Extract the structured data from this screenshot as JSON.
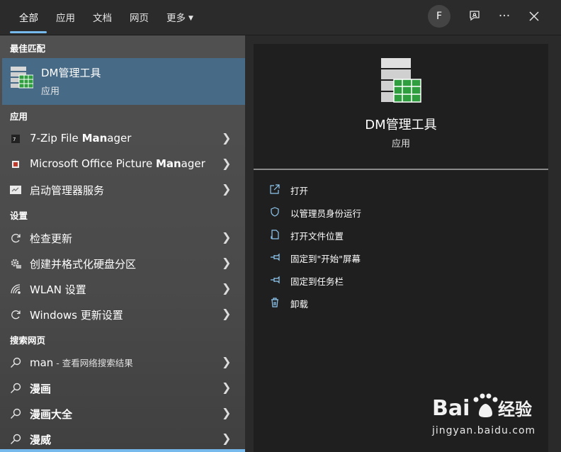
{
  "tabs": [
    {
      "label": "全部"
    },
    {
      "label": "应用"
    },
    {
      "label": "文档"
    },
    {
      "label": "网页"
    },
    {
      "label": "更多"
    }
  ],
  "avatar_letter": "F",
  "sections": {
    "best_match": "最佳匹配",
    "apps": "应用",
    "settings": "设置",
    "web": "搜索网页"
  },
  "best_match": {
    "title": "DM管理工具",
    "subtitle": "应用"
  },
  "apps": [
    {
      "pre": "7-Zip File ",
      "bold": "Man",
      "post": "ager",
      "icon": "7zip-icon"
    },
    {
      "pre": "Microsoft Office Picture ",
      "bold": "Man",
      "post": "ager",
      "icon": "office-picture-icon"
    },
    {
      "pre": "启动管理器服务",
      "bold": "",
      "post": "",
      "icon": "service-icon"
    }
  ],
  "settings": [
    {
      "label": "检查更新",
      "icon": "refresh-icon"
    },
    {
      "label": "创建并格式化硬盘分区",
      "icon": "disk-gear-icon"
    },
    {
      "label": "WLAN 设置",
      "icon": "wifi-icon"
    },
    {
      "label": "Windows 更新设置",
      "icon": "refresh-icon"
    }
  ],
  "web": [
    {
      "label": "man",
      "suffix": " - 查看网络搜索结果",
      "bold": false
    },
    {
      "label": "漫画",
      "suffix": "",
      "bold": true
    },
    {
      "label": "漫画大全",
      "suffix": "",
      "bold": true
    },
    {
      "label": "漫威",
      "suffix": "",
      "bold": true
    }
  ],
  "detail": {
    "title": "DM管理工具",
    "type": "应用",
    "actions": [
      {
        "label": "打开",
        "icon": "open-icon"
      },
      {
        "label": "以管理员身份运行",
        "icon": "shield-icon"
      },
      {
        "label": "打开文件位置",
        "icon": "file-location-icon"
      },
      {
        "label": "固定到\"开始\"屏幕",
        "icon": "pin-icon"
      },
      {
        "label": "固定到任务栏",
        "icon": "pin-icon"
      },
      {
        "label": "卸载",
        "icon": "trash-icon"
      }
    ]
  },
  "watermark": {
    "brand": "Bai",
    "brand2": "du",
    "cn": "经验",
    "url": "jingyan.baidu.com"
  },
  "colors": {
    "accent": "#76b9ed",
    "selected": "#476a87",
    "panel": "#1f1f1f"
  }
}
